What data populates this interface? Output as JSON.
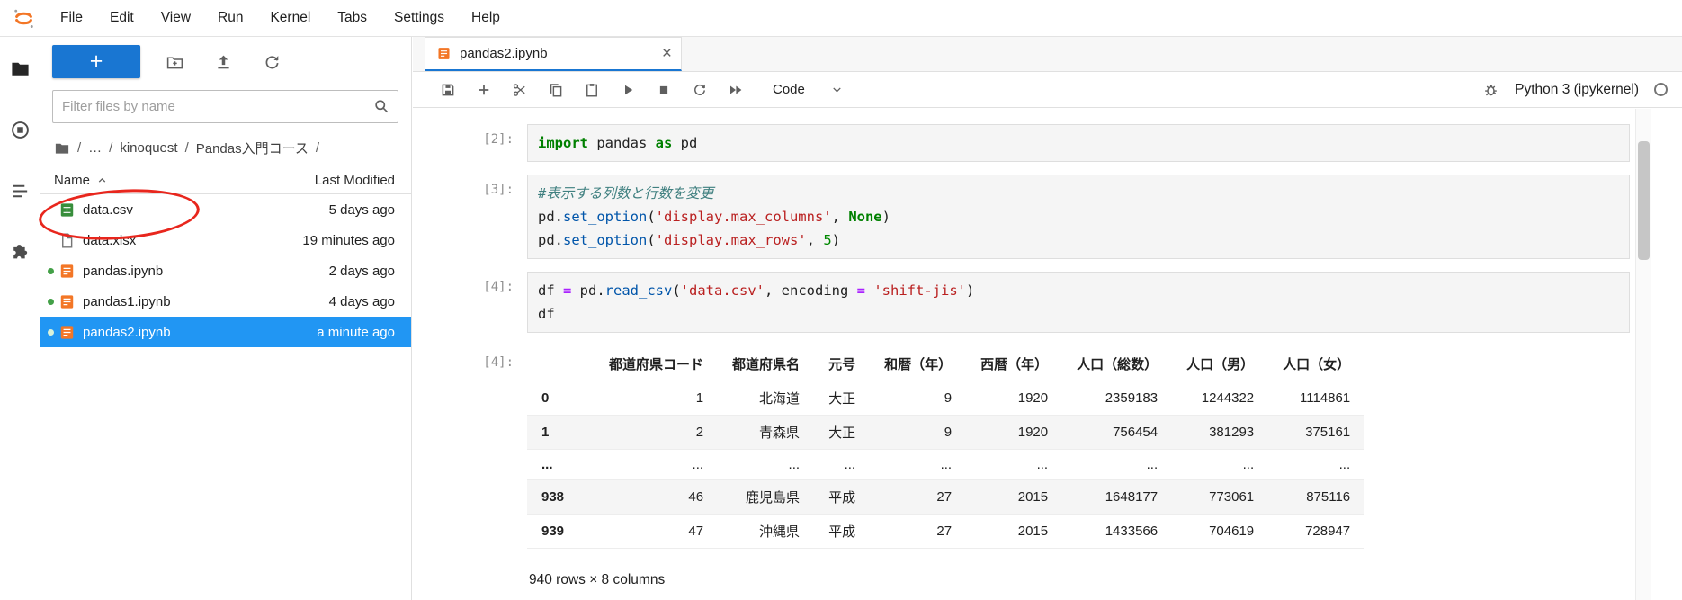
{
  "menu_bar": {
    "items": [
      "File",
      "Edit",
      "View",
      "Run",
      "Kernel",
      "Tabs",
      "Settings",
      "Help"
    ]
  },
  "activity_bar": {
    "items": [
      {
        "name": "file-browser",
        "icon": "folder",
        "active": true
      },
      {
        "name": "running-sessions",
        "icon": "running",
        "active": false
      },
      {
        "name": "table-of-contents",
        "icon": "toc",
        "active": false
      },
      {
        "name": "extension-manager",
        "icon": "puzzle",
        "active": false
      }
    ]
  },
  "file_browser": {
    "new_launcher": "+",
    "actions": [
      {
        "name": "new-folder",
        "icon": "new-folder"
      },
      {
        "name": "upload-files",
        "icon": "upload"
      },
      {
        "name": "refresh-file-list",
        "icon": "refresh"
      }
    ],
    "filter_placeholder": "Filter files by name",
    "breadcrumb": [
      {
        "type": "icon",
        "icon": "folder"
      },
      {
        "type": "sep",
        "label": "/"
      },
      {
        "type": "link",
        "label": "…"
      },
      {
        "type": "sep",
        "label": "/"
      },
      {
        "type": "link",
        "label": "kinoquest"
      },
      {
        "type": "sep",
        "label": "/"
      },
      {
        "type": "link",
        "label": "Pandas入門コース"
      },
      {
        "type": "sep",
        "label": "/"
      }
    ],
    "columns": {
      "name": "Name",
      "modified": "Last Modified"
    },
    "files": [
      {
        "name": "data.csv",
        "modified": "5 days ago",
        "icon": "csv",
        "running": false,
        "selected": false,
        "annotated": true
      },
      {
        "name": "data.xlsx",
        "modified": "19 minutes ago",
        "icon": "file",
        "running": false,
        "selected": false,
        "annotated": false
      },
      {
        "name": "pandas.ipynb",
        "modified": "2 days ago",
        "icon": "notebook",
        "running": true,
        "selected": false,
        "annotated": false
      },
      {
        "name": "pandas1.ipynb",
        "modified": "4 days ago",
        "icon": "notebook",
        "running": true,
        "selected": false,
        "annotated": false
      },
      {
        "name": "pandas2.ipynb",
        "modified": "a minute ago",
        "icon": "notebook",
        "running": true,
        "selected": true,
        "annotated": false
      }
    ]
  },
  "annotation": {
    "type": "ellipse",
    "color": "#e8261d",
    "target": "data.csv"
  },
  "main": {
    "tab": {
      "icon": "notebook",
      "title": "pandas2.ipynb",
      "close_icon": "×"
    },
    "toolbar": {
      "icons": [
        {
          "name": "save",
          "icon": "save"
        },
        {
          "name": "insert-cell",
          "icon": "add"
        },
        {
          "name": "cut-cell",
          "icon": "cut"
        },
        {
          "name": "copy-cell",
          "icon": "copy"
        },
        {
          "name": "paste-cell",
          "icon": "paste"
        },
        {
          "name": "run-cell",
          "icon": "run"
        },
        {
          "name": "interrupt-kernel",
          "icon": "stop"
        },
        {
          "name": "restart-kernel",
          "icon": "restart"
        },
        {
          "name": "restart-run-all",
          "icon": "fastforward"
        }
      ],
      "cell_type": "Code",
      "kernel_name": "Python 3 (ipykernel)"
    }
  },
  "notebook": {
    "cells": [
      {
        "prompt": "[2]:",
        "lines": [
          [
            [
              "import",
              "kw"
            ],
            [
              " pandas ",
              ""
            ],
            [
              "as",
              "kw"
            ],
            [
              " pd",
              ""
            ]
          ]
        ]
      },
      {
        "prompt": "[3]:",
        "lines": [
          [
            [
              "#表示する列数と行数を変更",
              "cm"
            ]
          ],
          [
            [
              "pd.",
              ""
            ],
            [
              "set_option",
              "prop"
            ],
            [
              "(",
              ""
            ],
            [
              "'display.max_columns'",
              "str"
            ],
            [
              ", ",
              ""
            ],
            [
              "None",
              "kw"
            ],
            [
              ")",
              ""
            ]
          ],
          [
            [
              "pd.",
              ""
            ],
            [
              "set_option",
              "prop"
            ],
            [
              "(",
              ""
            ],
            [
              "'display.max_rows'",
              "str"
            ],
            [
              ", ",
              ""
            ],
            [
              "5",
              "num"
            ],
            [
              ")",
              ""
            ]
          ]
        ]
      },
      {
        "prompt": "[4]:",
        "lines": [
          [
            [
              "df ",
              ""
            ],
            [
              "=",
              "op"
            ],
            [
              " pd.",
              ""
            ],
            [
              "read_csv",
              "prop"
            ],
            [
              "(",
              ""
            ],
            [
              "'data.csv'",
              "str"
            ],
            [
              ", encoding ",
              ""
            ],
            [
              "=",
              "op"
            ],
            [
              " ",
              ""
            ],
            [
              "'shift-jis'",
              "str"
            ],
            [
              ")",
              ""
            ]
          ],
          [
            [
              "df",
              ""
            ]
          ]
        ]
      }
    ],
    "output": {
      "prompt": "[4]:",
      "table": {
        "columns": [
          "都道府県コード",
          "都道府県名",
          "元号",
          "和暦（年）",
          "西暦（年）",
          "人口（総数）",
          "人口（男）",
          "人口（女）"
        ],
        "rows": [
          {
            "index": "0",
            "values": [
              "1",
              "北海道",
              "大正",
              "9",
              "1920",
              "2359183",
              "1244322",
              "1114861"
            ]
          },
          {
            "index": "1",
            "values": [
              "2",
              "青森県",
              "大正",
              "9",
              "1920",
              "756454",
              "381293",
              "375161"
            ]
          },
          {
            "index": "...",
            "values": [
              "...",
              "...",
              "...",
              "...",
              "...",
              "...",
              "...",
              "..."
            ]
          },
          {
            "index": "938",
            "values": [
              "46",
              "鹿児島県",
              "平成",
              "27",
              "2015",
              "1648177",
              "773061",
              "875116"
            ]
          },
          {
            "index": "939",
            "values": [
              "47",
              "沖縄県",
              "平成",
              "27",
              "2015",
              "1433566",
              "704619",
              "728947"
            ]
          }
        ]
      },
      "summary": "940 rows × 8 columns"
    }
  },
  "colors": {
    "accent_blue": "#1976d2",
    "selection_blue": "#2196f3",
    "jupyter_orange": "#f37626",
    "csv_green": "#388e3c",
    "running_green": "#43a047",
    "annotation_red": "#e8261d"
  }
}
